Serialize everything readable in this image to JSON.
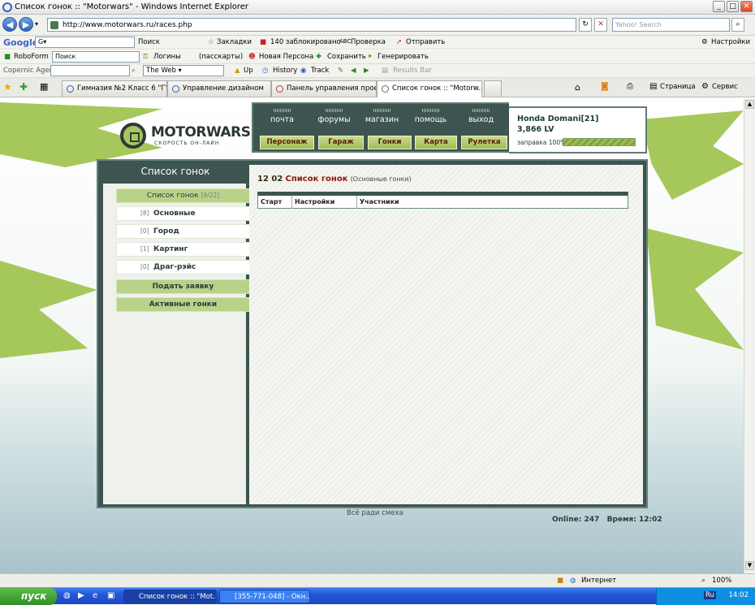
{
  "window": {
    "title": "Список гонок :: \"Motorwars\" - Windows Internet Explorer",
    "minimize": "_",
    "maximize": "□",
    "close": "✕"
  },
  "address_bar": {
    "url": "http://www.motorwars.ru/races.php",
    "search_placeholder": "Yahoo! Search"
  },
  "google_toolbar": {
    "logo": "Google",
    "search_label": "Поиск",
    "bookmarks": "Закладки",
    "blocked": "140 заблокировано",
    "check": "Проверка",
    "send": "Отправить",
    "settings": "Настройки"
  },
  "roboform_toolbar": {
    "roboform": "RoboForm",
    "search_value": "Поиск",
    "logins": "Логины",
    "passcards": "(пасскарты)",
    "new_persona": "Новая Персона",
    "save": "Сохранить",
    "generate": "Генерировать"
  },
  "copernic_toolbar": {
    "agent": "Copernic Agent",
    "web": "The Web",
    "up": "Up",
    "history": "History",
    "track": "Track",
    "results": "Results Bar"
  },
  "tabs": [
    {
      "label": "Гимназия №2 Класс 6 \"Г\" - ..."
    },
    {
      "label": "Управление дизайном"
    },
    {
      "label": "Панель управления проект..."
    },
    {
      "label": "Список гонок :: \"Motorw..."
    }
  ],
  "command_bar": {
    "page": "Страница",
    "tools": "Сервис"
  },
  "site": {
    "logo_text": "MOTORWARS.RU",
    "logo_sub": "СКОРОСТЬ ОН-ЛАЙН",
    "nav_top": [
      "почта",
      "форумы",
      "магазин",
      "помощь",
      "выход"
    ],
    "nav_bottom": [
      "Персонаж",
      "Гараж",
      "Гонки",
      "Карта",
      "Рулетка"
    ],
    "car_name": "Honda Domani[21]",
    "money": "3,866 LV",
    "fuel_label": "заправка 100%",
    "fuel_level": 1.0
  },
  "sidebar": {
    "title": "Список гонок",
    "header": {
      "label": "Список гонок",
      "count": "[9/22]"
    },
    "items": [
      {
        "count": "[8]",
        "label": "Основные"
      },
      {
        "count": "[0]",
        "label": "Город"
      },
      {
        "count": "[1]",
        "label": "Картинг"
      },
      {
        "count": "[0]",
        "label": "Драг-рэйс"
      }
    ],
    "apply": "Подать заявку",
    "active": "Активные гонки"
  },
  "content": {
    "time": "12 02",
    "title": "Список гонок",
    "subtitle": "(Основные гонки)",
    "columns": [
      "Старт",
      "Настройки",
      "Участники"
    ]
  },
  "footer": {
    "note": "Всё ради смеха",
    "online": "Online: 247",
    "time": "Время: 12:02"
  },
  "statusbar": {
    "zone": "Интернет",
    "zoom": "100%"
  },
  "taskbar": {
    "start": "пуск",
    "tasks": [
      "Список гонок :: \"Mot...",
      "[355-771-048] - Окн..."
    ],
    "clock": "14:02",
    "lang": "Ru"
  }
}
